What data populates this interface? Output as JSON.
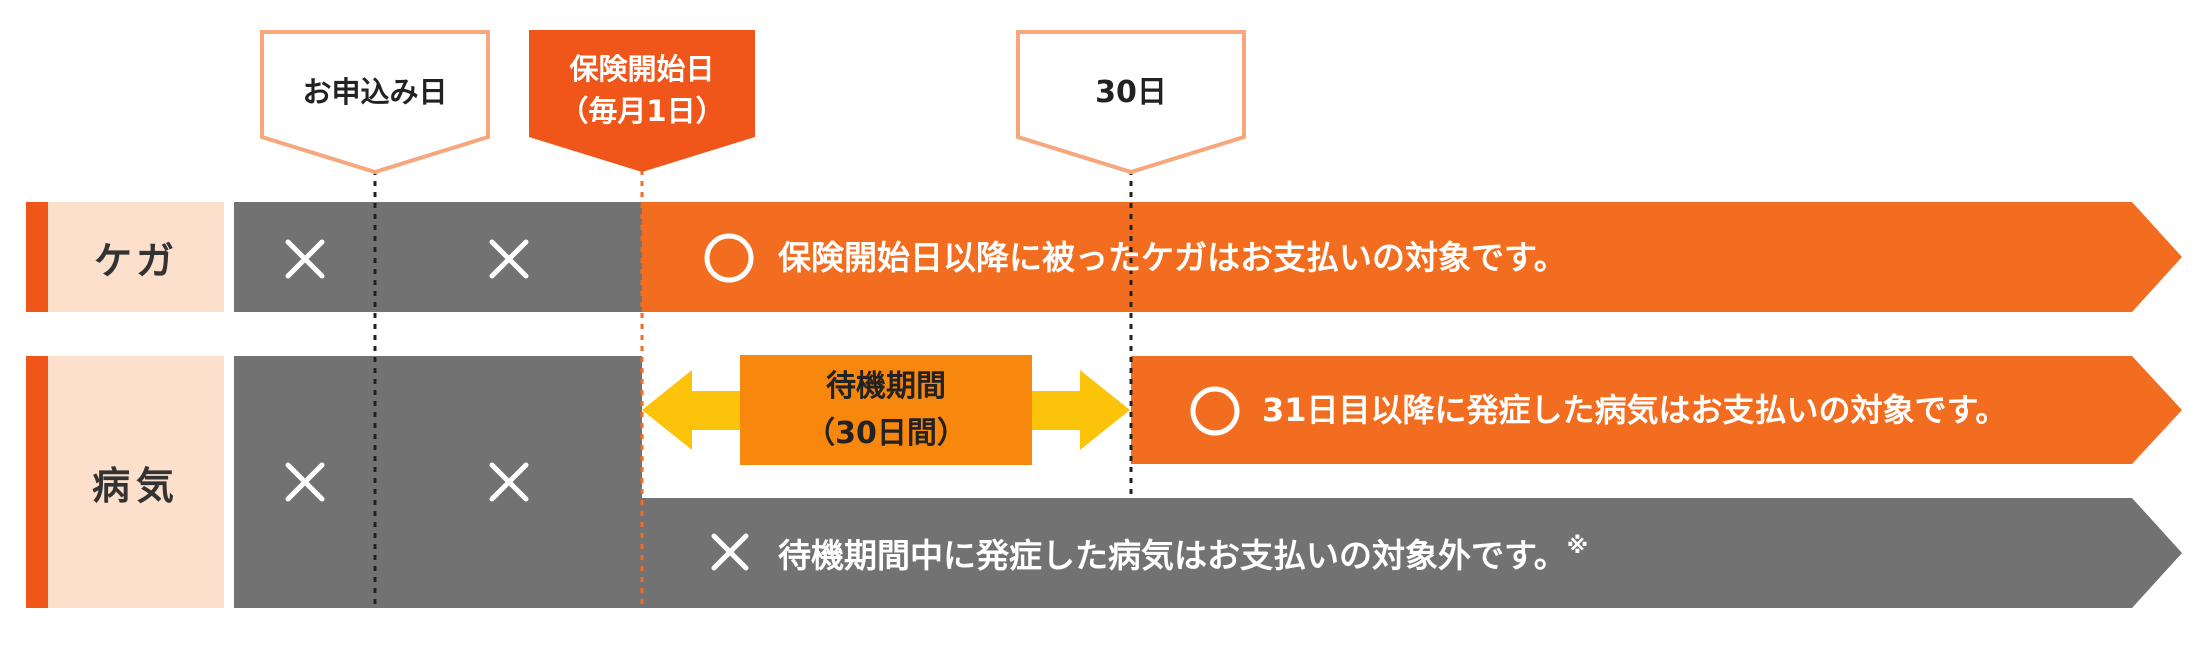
{
  "markers": {
    "application": {
      "label": "お申込み日"
    },
    "start": {
      "line1": "保険開始日",
      "line2": "（毎月1日）"
    },
    "day30": {
      "label": "30日"
    }
  },
  "rows": {
    "injury": {
      "label": "ケガ",
      "message": "保険開始日以降に被ったケガはお支払いの対象です。"
    },
    "illness": {
      "label": "病気",
      "message_covered": "31日目以降に発症した病気はお支払いの対象です。",
      "message_excluded": "待機期間中に発症した病気はお支払いの対象外です。",
      "note_mark": "※"
    }
  },
  "waiting_period": {
    "line1": "待機期間",
    "line2": "（30日間）"
  },
  "colors": {
    "orange": "#f26d1f",
    "accent_red": "#f0561a",
    "gray": "#727272",
    "label_bg": "#fde0cc",
    "waiting_box": "#f8870e",
    "arrow_yellow": "#fcc30b",
    "marker_border": "#f6a77b"
  }
}
